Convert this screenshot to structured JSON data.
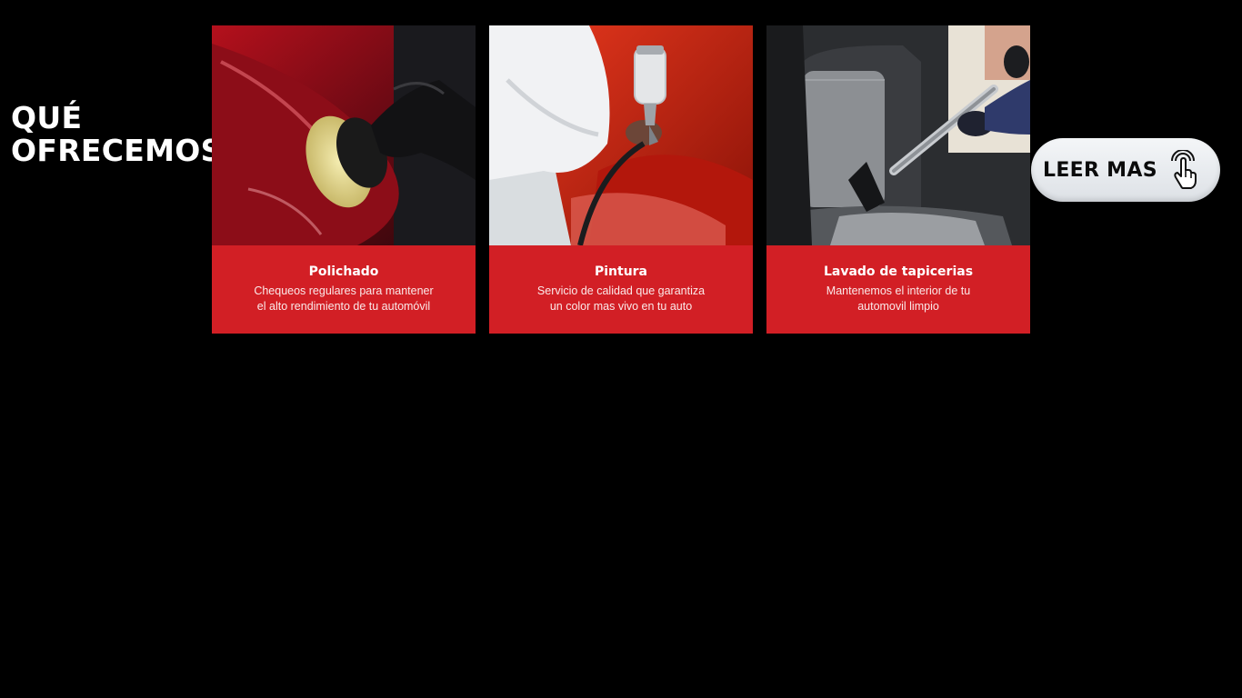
{
  "section": {
    "heading_line1": "QUÉ",
    "heading_line2": "OFRECEMOS"
  },
  "cards": [
    {
      "title": "Polichado",
      "desc_line1": "Chequeos regulares para mantener",
      "desc_line2": "el alto rendimiento de tu automóvil",
      "image": "car-polishing-photo"
    },
    {
      "title": "Pintura",
      "desc_line1": "Servicio de calidad que garantiza",
      "desc_line2": "un color mas vivo en tu auto",
      "image": "spray-painting-photo"
    },
    {
      "title": "Lavado de tapicerias",
      "desc_line1": "Mantenemos el interior de tu",
      "desc_line2": "automovil limpio",
      "image": "upholstery-cleaning-photo"
    }
  ],
  "cta": {
    "label": "LEER MAS",
    "icon": "pointer-tap-icon"
  },
  "colors": {
    "background": "#000000",
    "card_accent": "#d21f25",
    "button_bg": "#eef0f3"
  }
}
